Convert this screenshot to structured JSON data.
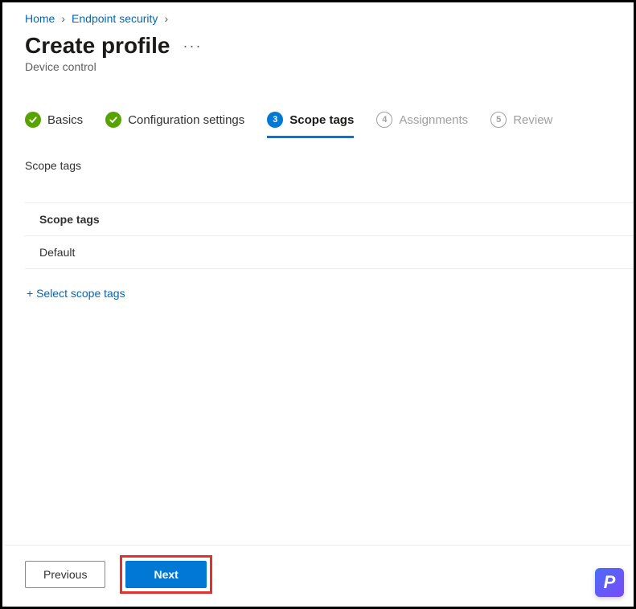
{
  "breadcrumb": {
    "items": [
      {
        "label": "Home"
      },
      {
        "label": "Endpoint security"
      }
    ]
  },
  "page": {
    "title": "Create profile",
    "subtitle": "Device control",
    "more_label": "···"
  },
  "wizard": {
    "steps": [
      {
        "label": "Basics",
        "state": "done"
      },
      {
        "label": "Configuration settings",
        "state": "done"
      },
      {
        "label": "Scope tags",
        "state": "current",
        "number": "3"
      },
      {
        "label": "Assignments",
        "state": "pending",
        "number": "4"
      },
      {
        "label": "Review",
        "state": "pending",
        "number": "5"
      }
    ]
  },
  "section": {
    "heading": "Scope tags",
    "table_header": "Scope tags",
    "rows": [
      {
        "label": "Default"
      }
    ],
    "select_link": "+ Select scope tags"
  },
  "footer": {
    "previous": "Previous",
    "next": "Next"
  },
  "brand": {
    "letter": "P"
  }
}
